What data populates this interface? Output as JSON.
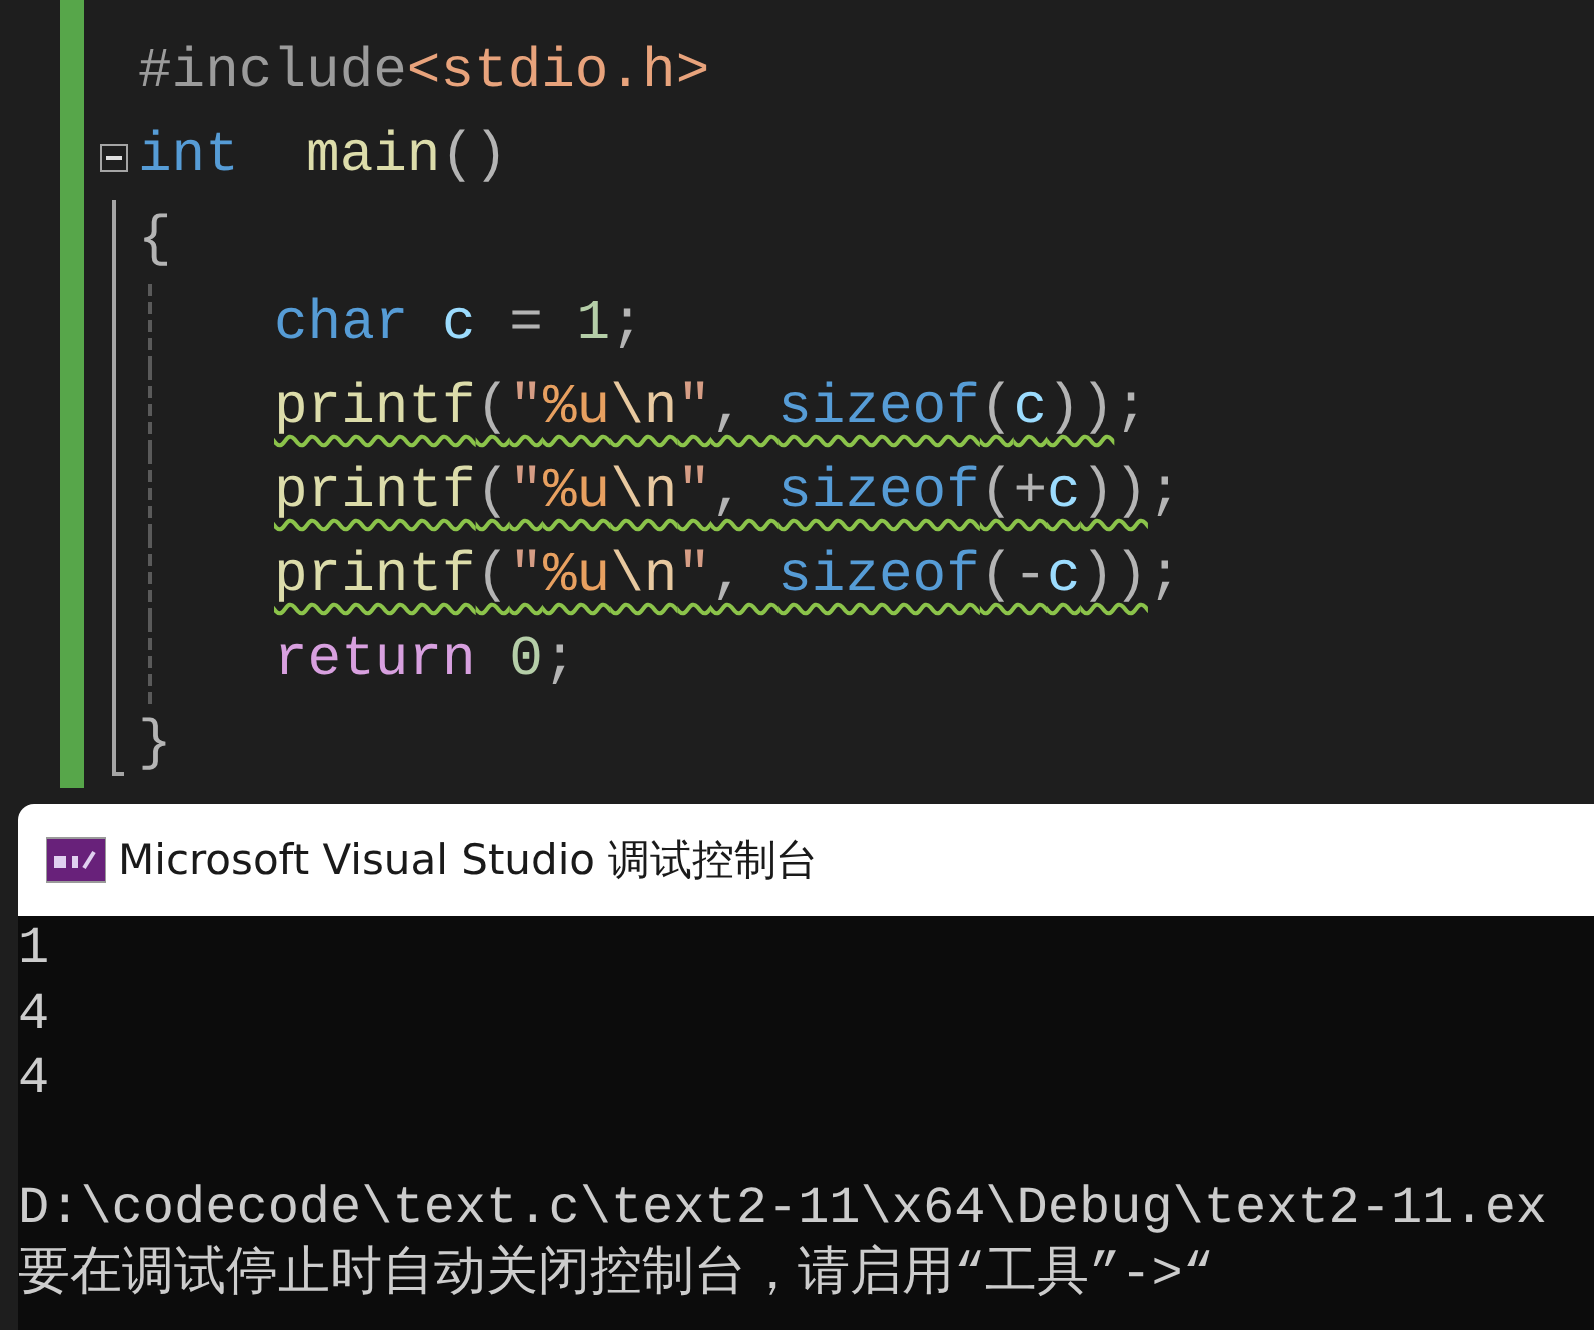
{
  "editor": {
    "lines": [
      {
        "indented": false,
        "tokens": [
          {
            "kind": "preprocessor",
            "text": "#include"
          },
          {
            "kind": "include-path",
            "text": "<stdio.h>"
          }
        ]
      },
      {
        "indented": false,
        "foldable": true,
        "tokens": [
          {
            "kind": "keyword",
            "text": "int  "
          },
          {
            "kind": "function",
            "text": "main"
          },
          {
            "kind": "punct",
            "text": "()"
          }
        ]
      },
      {
        "indented": false,
        "tokens": [
          {
            "kind": "punct",
            "text": "{"
          }
        ]
      },
      {
        "indented": true,
        "tokens": [
          {
            "kind": "keyword",
            "text": "char "
          },
          {
            "kind": "variable",
            "text": "c"
          },
          {
            "kind": "punct",
            "text": " = "
          },
          {
            "kind": "number",
            "text": "1"
          },
          {
            "kind": "punct",
            "text": ";"
          }
        ]
      },
      {
        "indented": true,
        "tokens": [
          {
            "kind": "function",
            "text": "printf",
            "warning": true
          },
          {
            "kind": "punct",
            "text": "(",
            "warning": true
          },
          {
            "kind": "string",
            "text": "\"",
            "warning": true
          },
          {
            "kind": "format",
            "text": "%u",
            "warning": true
          },
          {
            "kind": "escape",
            "text": "\\n",
            "warning": true
          },
          {
            "kind": "string",
            "text": "\"",
            "warning": true
          },
          {
            "kind": "punct",
            "text": ", ",
            "warning": true
          },
          {
            "kind": "keyword",
            "text": "sizeof",
            "warning": true
          },
          {
            "kind": "punct",
            "text": "(",
            "warning": true
          },
          {
            "kind": "variable",
            "text": "c",
            "warning": true
          },
          {
            "kind": "punct",
            "text": "))",
            "warning": true
          },
          {
            "kind": "punct",
            "text": ";"
          }
        ]
      },
      {
        "indented": true,
        "tokens": [
          {
            "kind": "function",
            "text": "printf",
            "warning": true
          },
          {
            "kind": "punct",
            "text": "(",
            "warning": true
          },
          {
            "kind": "string",
            "text": "\"",
            "warning": true
          },
          {
            "kind": "format",
            "text": "%u",
            "warning": true
          },
          {
            "kind": "escape",
            "text": "\\n",
            "warning": true
          },
          {
            "kind": "string",
            "text": "\"",
            "warning": true
          },
          {
            "kind": "punct",
            "text": ", ",
            "warning": true
          },
          {
            "kind": "keyword",
            "text": "sizeof",
            "warning": true
          },
          {
            "kind": "punct",
            "text": "(+",
            "warning": true
          },
          {
            "kind": "variable",
            "text": "c",
            "warning": true
          },
          {
            "kind": "punct",
            "text": "))",
            "warning": true
          },
          {
            "kind": "punct",
            "text": ";"
          }
        ]
      },
      {
        "indented": true,
        "tokens": [
          {
            "kind": "function",
            "text": "printf",
            "warning": true
          },
          {
            "kind": "punct",
            "text": "(",
            "warning": true
          },
          {
            "kind": "string",
            "text": "\"",
            "warning": true
          },
          {
            "kind": "format",
            "text": "%u",
            "warning": true
          },
          {
            "kind": "escape",
            "text": "\\n",
            "warning": true
          },
          {
            "kind": "string",
            "text": "\"",
            "warning": true
          },
          {
            "kind": "punct",
            "text": ", ",
            "warning": true
          },
          {
            "kind": "keyword",
            "text": "sizeof",
            "warning": true
          },
          {
            "kind": "punct",
            "text": "(-",
            "warning": true
          },
          {
            "kind": "variable",
            "text": "c",
            "warning": true
          },
          {
            "kind": "punct",
            "text": "))",
            "warning": true
          },
          {
            "kind": "punct",
            "text": ";"
          }
        ]
      },
      {
        "indented": true,
        "tokens": [
          {
            "kind": "control",
            "text": "return "
          },
          {
            "kind": "number",
            "text": "0"
          },
          {
            "kind": "punct",
            "text": ";"
          }
        ]
      },
      {
        "indented": false,
        "tokens": [
          {
            "kind": "punct",
            "text": "}"
          }
        ]
      }
    ]
  },
  "console": {
    "title": "Microsoft Visual Studio 调试控制台",
    "output": [
      "1",
      "4",
      "4"
    ],
    "messages": [
      "D:\\codecode\\text.c\\text2-11\\x64\\Debug\\text2-11.ex",
      "要在调试停止时自动关闭控制台，请启用“工具”->“"
    ]
  }
}
